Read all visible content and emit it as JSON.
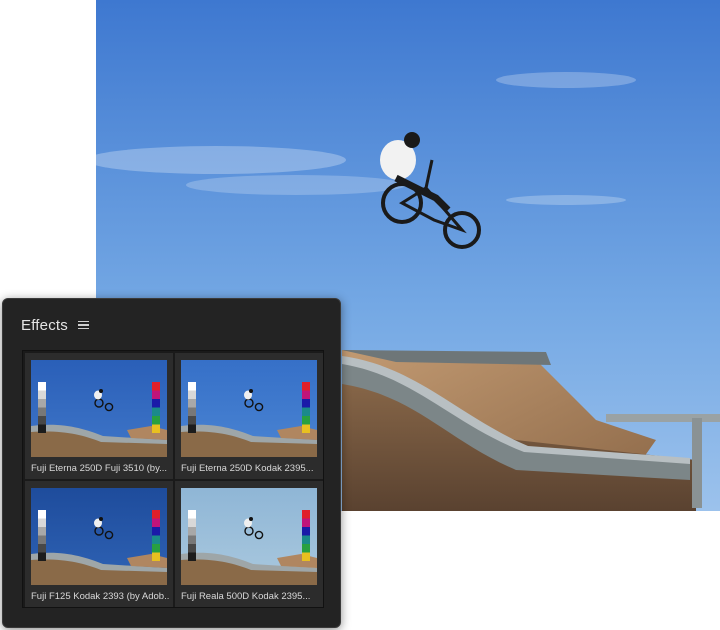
{
  "panel": {
    "title": "Effects",
    "menu_icon": "hamburger-menu-icon"
  },
  "presets": [
    {
      "label": "Fuji Eterna 250D Fuji 3510 (by...",
      "sky": "#3f76c8",
      "sky_top": "#2a5fb8"
    },
    {
      "label": "Fuji Eterna 250D Kodak 2395...",
      "sky": "#4a84d2",
      "sky_top": "#3670c8"
    },
    {
      "label": "Fuji F125 Kodak 2393 (by Adob...",
      "sky": "#2f63b5",
      "sky_top": "#1e4c9c"
    },
    {
      "label": "Fuji Reala 500D Kodak 2395...",
      "sky": "#a9c8de",
      "sky_top": "#8fb6d6"
    }
  ],
  "colors": {
    "panel_bg": "#232323",
    "card_bg": "#2c2c2c",
    "swatches": [
      "#e0202a",
      "#c0147a",
      "#1a1aa8",
      "#1a8a8a",
      "#28a040",
      "#e8c020"
    ]
  }
}
